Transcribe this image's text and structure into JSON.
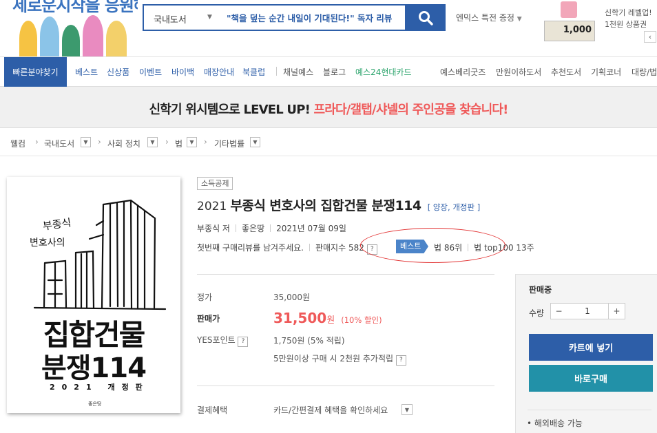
{
  "header": {
    "slogan": "세로운시작을 응원해",
    "search": {
      "category": "국내도서",
      "value": "\"책을 덮는 순간 내일이 기대된다!\" 독자 리뷰"
    },
    "promo_link": "엔믹스 특전 증정",
    "gift": {
      "amount": "1,000",
      "line1": "신학기 레벨업!",
      "line2": "1천원 상품권"
    }
  },
  "nav": {
    "quick": "빠른분야찾기",
    "items": [
      "베스트",
      "신상품",
      "이벤트",
      "바이백",
      "매장안내",
      "북클럽",
      "채널예스",
      "블로그",
      "예스24현대카드",
      "예스베리굿즈",
      "만원이하도서",
      "추천도서",
      "기획코너",
      "대량/법"
    ]
  },
  "banner": {
    "part1": "신학기 위시템으로 LEVEL UP!",
    "part2": "프라다/갤탭/샤넬의 주인공을 찾습니다!"
  },
  "breadcrumb": [
    "웰컴",
    "국내도서",
    "사회 정치",
    "법",
    "기타법률"
  ],
  "cover": {
    "author_line1": "부종식",
    "author_line2": "변호사의",
    "title_line1": "집합건물",
    "title_line2": "분쟁114",
    "edition": "2021 개정판",
    "publisher": "좋은땅"
  },
  "product": {
    "tag": "소득공제",
    "title_year": "2021",
    "title": "부종식 변호사의 집합건물 분쟁114",
    "title_sub": "[ 양장, 개정판 ]",
    "author": "부종식 저",
    "publisher": "좋은땅",
    "date": "2021년 07월 09일",
    "review_prompt": "첫번째 구매리뷰를 남겨주세요.",
    "sales_index_label": "판매지수",
    "sales_index": "582",
    "best_badge": "베스트",
    "rank1": "법 86위",
    "rank2": "법 top100 13주",
    "qmark": "?"
  },
  "price": {
    "list_label": "정가",
    "list_value": "35,000원",
    "sale_label": "판매가",
    "sale_num": "31,500",
    "sale_unit": "원",
    "sale_pct": "(10% 할인)",
    "points_label": "YES포인트",
    "points_value": "1,750원 (5% 적립)",
    "extra_points": "5만원이상 구매 시 2천원 추가적립",
    "payment_label": "결제혜택",
    "payment_value": "카드/간편결제 혜택을 확인하세요"
  },
  "buy": {
    "status": "판매중",
    "qty_label": "수량",
    "qty": "1",
    "minus": "−",
    "plus": "+",
    "cart": "카트에 넣기",
    "buy_now": "바로구매",
    "overseas": "• 해외배송 가능"
  },
  "colors": {
    "brand_blue": "#2d5ea8",
    "sale_red": "#ef5a5a",
    "buy_teal": "#2291a8",
    "highlight_oval": "#e23232"
  }
}
